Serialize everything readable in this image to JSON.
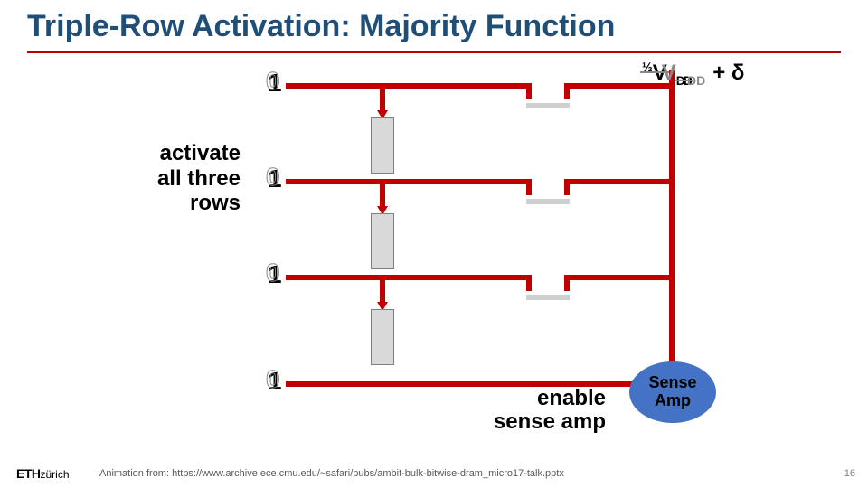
{
  "title": "Triple-Row Activation: Majority Function",
  "activate_label": "activate\nall three\nrows",
  "enable_label": "enable\nsense amp",
  "voltage_half": "½",
  "voltage_V": "V",
  "voltage_DD": "DD",
  "voltage_delta": "+ δ",
  "bits": [
    "1",
    "1",
    "1",
    "1"
  ],
  "bits_ghost": [
    "0",
    "0",
    "0",
    "0"
  ],
  "senseamp_label": "Sense\nAmp",
  "footer": "Animation from: https://www.archive.ece.cmu.edu/~safari/pubs/ambit-bulk-bitwise-dram_micro17-talk.pptx",
  "page": "16",
  "logo_main": "ETH",
  "logo_sub": "zürich",
  "chart_data": {
    "type": "diagram",
    "description": "DRAM triple-row activation performing majority function",
    "rows": 4,
    "row_bits": [
      1,
      1,
      1,
      1
    ],
    "bitline_voltage": "½V_DD + δ",
    "components": [
      "wordlines",
      "access-transistors",
      "cell-capacitors",
      "bitline",
      "sense-amplifier"
    ],
    "action_labels": [
      "activate all three rows",
      "enable sense amp"
    ]
  }
}
